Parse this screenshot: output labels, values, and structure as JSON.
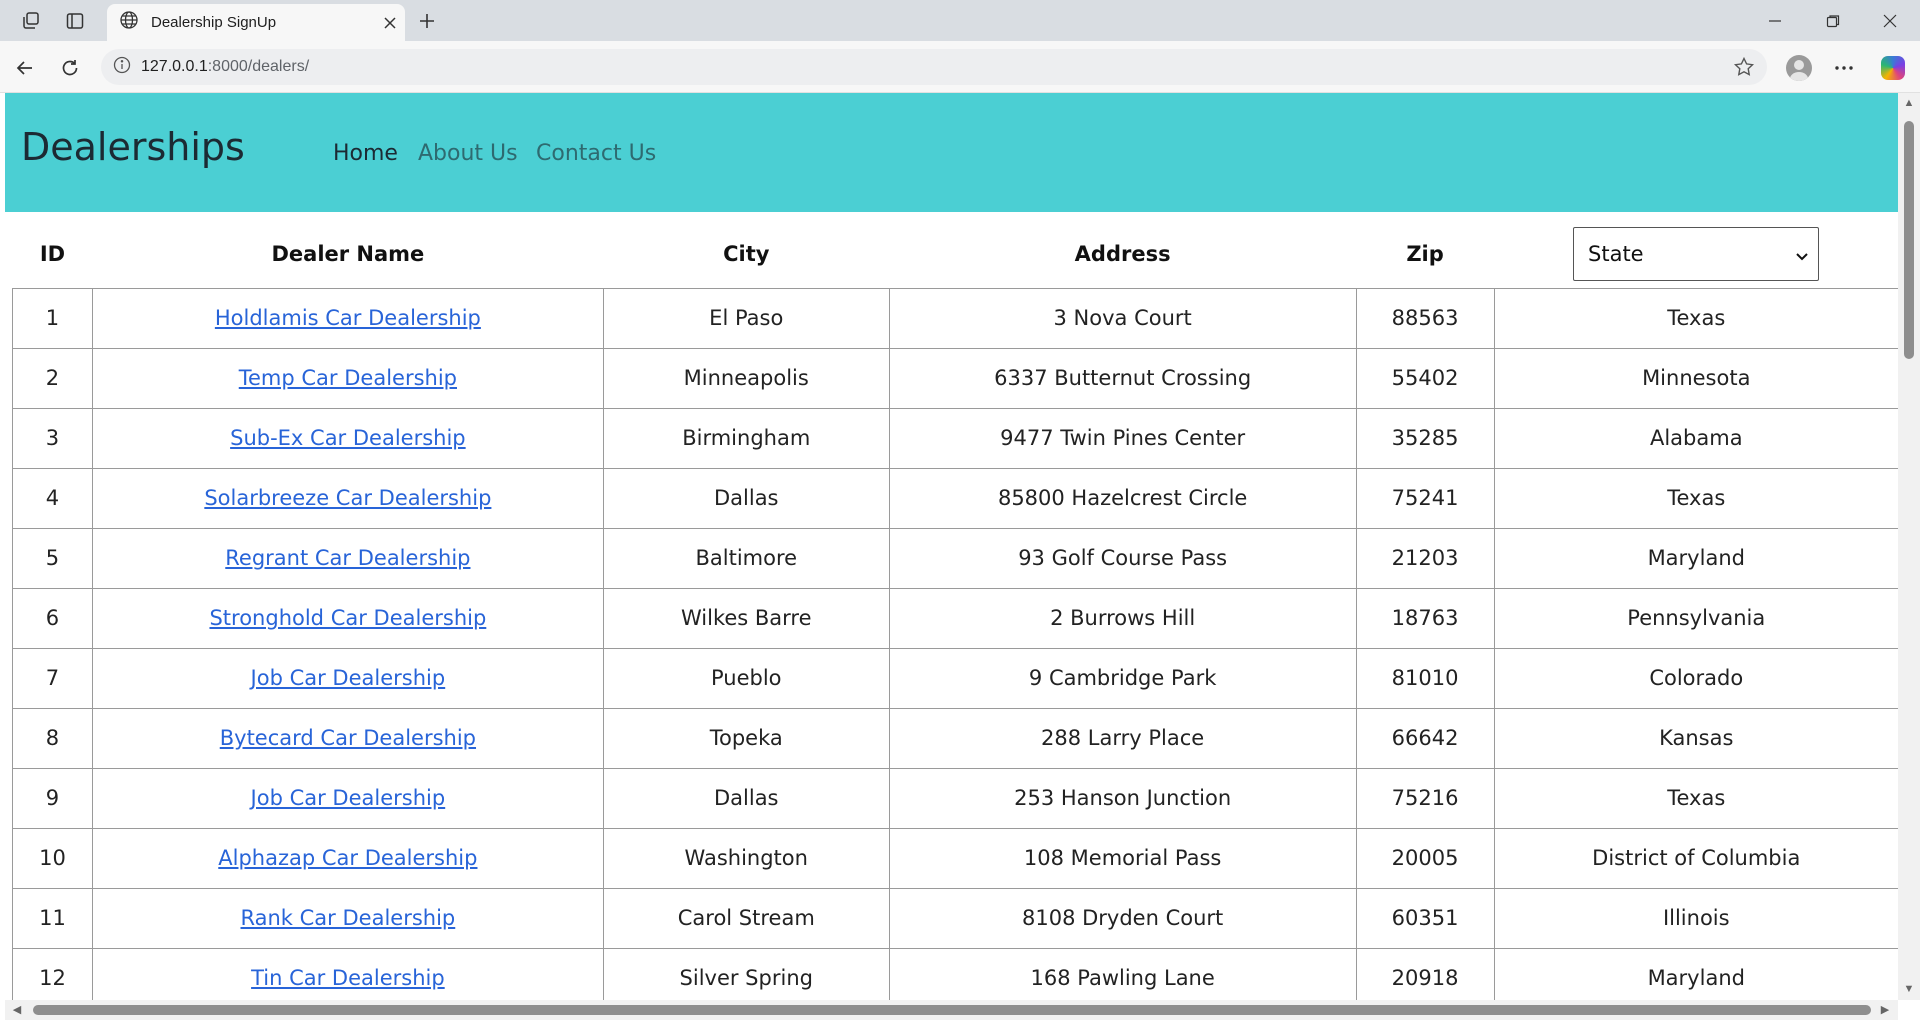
{
  "browser": {
    "tab_title": "Dealership SignUp",
    "url_host": "127.0.0.1",
    "url_rest": ":8000/dealers/",
    "icons": {
      "workspaces": "workspaces-icon",
      "tab_actions": "tab-actions-icon",
      "globe": "globe-icon",
      "close_tab": "close-icon",
      "new_tab": "plus-icon",
      "back": "back-arrow-icon",
      "reload": "reload-icon",
      "site_info": "info-icon",
      "favorite": "star-icon",
      "profile": "profile-icon",
      "more": "more-icon",
      "copilot": "copilot-icon"
    }
  },
  "page": {
    "brand": "Dealerships",
    "nav": [
      {
        "label": "Home",
        "active": true
      },
      {
        "label": "About Us",
        "active": false
      },
      {
        "label": "Contact Us",
        "active": false
      }
    ],
    "header_color": "#4bcfd3",
    "link_color": "#2864d8"
  },
  "table": {
    "columns": {
      "id": "ID",
      "name": "Dealer Name",
      "city": "City",
      "address": "Address",
      "zip": "Zip"
    },
    "state_select": {
      "selected": "State"
    },
    "rows": [
      {
        "id": "1",
        "name": "Holdlamis Car Dealership",
        "city": "El Paso",
        "address": "3 Nova Court",
        "zip": "88563",
        "state": "Texas"
      },
      {
        "id": "2",
        "name": "Temp Car Dealership",
        "city": "Minneapolis",
        "address": "6337 Butternut Crossing",
        "zip": "55402",
        "state": "Minnesota"
      },
      {
        "id": "3",
        "name": "Sub-Ex Car Dealership",
        "city": "Birmingham",
        "address": "9477 Twin Pines Center",
        "zip": "35285",
        "state": "Alabama"
      },
      {
        "id": "4",
        "name": "Solarbreeze Car Dealership",
        "city": "Dallas",
        "address": "85800 Hazelcrest Circle",
        "zip": "75241",
        "state": "Texas"
      },
      {
        "id": "5",
        "name": "Regrant Car Dealership",
        "city": "Baltimore",
        "address": "93 Golf Course Pass",
        "zip": "21203",
        "state": "Maryland"
      },
      {
        "id": "6",
        "name": "Stronghold Car Dealership",
        "city": "Wilkes Barre",
        "address": "2 Burrows Hill",
        "zip": "18763",
        "state": "Pennsylvania"
      },
      {
        "id": "7",
        "name": "Job Car Dealership",
        "city": "Pueblo",
        "address": "9 Cambridge Park",
        "zip": "81010",
        "state": "Colorado"
      },
      {
        "id": "8",
        "name": "Bytecard Car Dealership",
        "city": "Topeka",
        "address": "288 Larry Place",
        "zip": "66642",
        "state": "Kansas"
      },
      {
        "id": "9",
        "name": "Job Car Dealership",
        "city": "Dallas",
        "address": "253 Hanson Junction",
        "zip": "75216",
        "state": "Texas"
      },
      {
        "id": "10",
        "name": "Alphazap Car Dealership",
        "city": "Washington",
        "address": "108 Memorial Pass",
        "zip": "20005",
        "state": "District of Columbia"
      },
      {
        "id": "11",
        "name": "Rank Car Dealership",
        "city": "Carol Stream",
        "address": "8108 Dryden Court",
        "zip": "60351",
        "state": "Illinois"
      },
      {
        "id": "12",
        "name": "Tin Car Dealership",
        "city": "Silver Spring",
        "address": "168 Pawling Lane",
        "zip": "20918",
        "state": "Maryland"
      }
    ]
  }
}
